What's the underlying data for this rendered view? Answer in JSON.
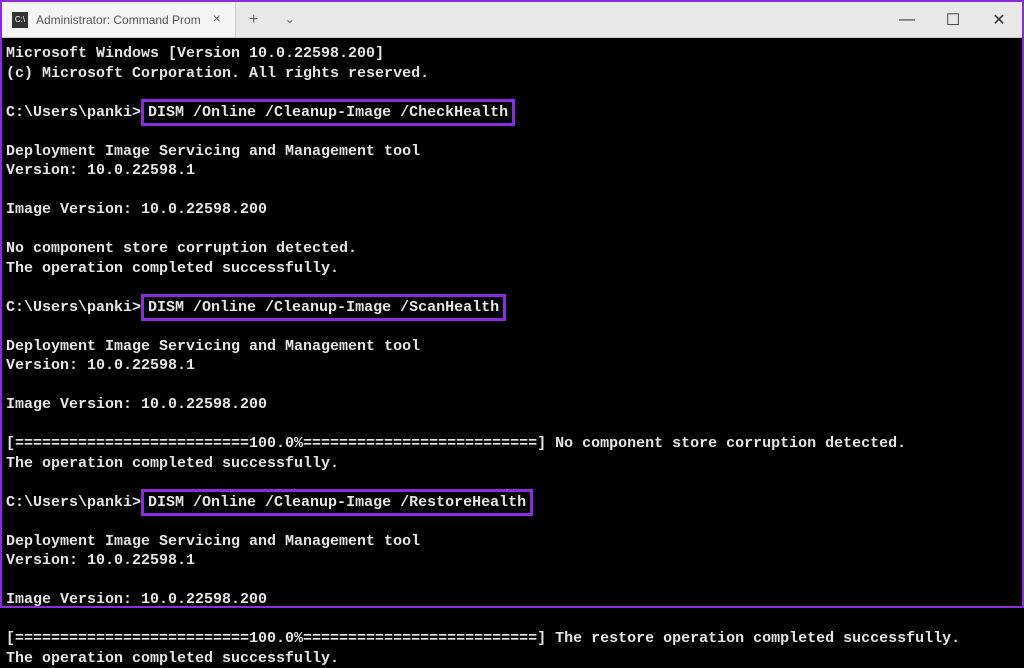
{
  "titlebar": {
    "tab_title": "Administrator: Command Prom",
    "tab_icon_label": "C:\\",
    "close_glyph": "×",
    "newtab_glyph": "+",
    "expand_glyph": "⌄",
    "minimize_glyph": "—",
    "maximize_glyph": "☐",
    "closewin_glyph": "✕"
  },
  "term": {
    "header1": "Microsoft Windows [Version 10.0.22598.200]",
    "header2": "(c) Microsoft Corporation. All rights reserved.",
    "prompt1_path": "C:\\Users\\panki>",
    "cmd1": "DISM /Online /Cleanup-Image /CheckHealth",
    "tool_name": "Deployment Image Servicing and Management tool",
    "tool_version": "Version: 10.0.22598.1",
    "image_version": "Image Version: 10.0.22598.200",
    "no_corrupt": "No component store corruption detected.",
    "completed": "The operation completed successfully.",
    "prompt2_path": "C:\\Users\\panki>",
    "cmd2": "DISM /Online /Cleanup-Image /ScanHealth",
    "progress_line2": "[==========================100.0%==========================] No component store corruption detected.",
    "prompt3_path": "C:\\Users\\panki>",
    "cmd3": "DISM /Online /Cleanup-Image /RestoreHealth",
    "progress_line3": "[==========================100.0%==========================] The restore operation completed successfully."
  }
}
